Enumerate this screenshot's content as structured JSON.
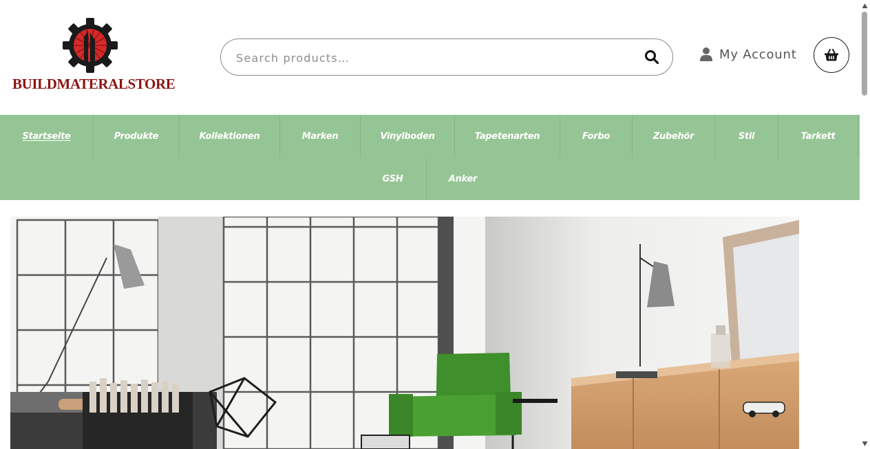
{
  "header": {
    "logo_text": "BUILDMATERALSTORE",
    "search": {
      "placeholder": "Search products…",
      "value": ""
    },
    "account_label": "My Account"
  },
  "nav": {
    "row1": [
      "Startseite",
      "Produkte",
      "Kollektionen",
      "Marken",
      "Vinylboden",
      "Tapetenarten",
      "Forbo",
      "Zubehör",
      "Stil",
      "Tarkett"
    ],
    "row2": [
      "GSH",
      "Anker"
    ],
    "active": "Startseite"
  },
  "colors": {
    "nav_background": "#96c595",
    "nav_text": "#ffffff",
    "logo_red": "#8b1414",
    "logo_accent": "#d42a2a",
    "gear": "#1a1a1a",
    "chair_green": "#3f8f2c"
  },
  "icons": {
    "search": "search-icon",
    "account": "user-icon",
    "cart": "basket-icon",
    "logo": "gear-logo-icon"
  }
}
